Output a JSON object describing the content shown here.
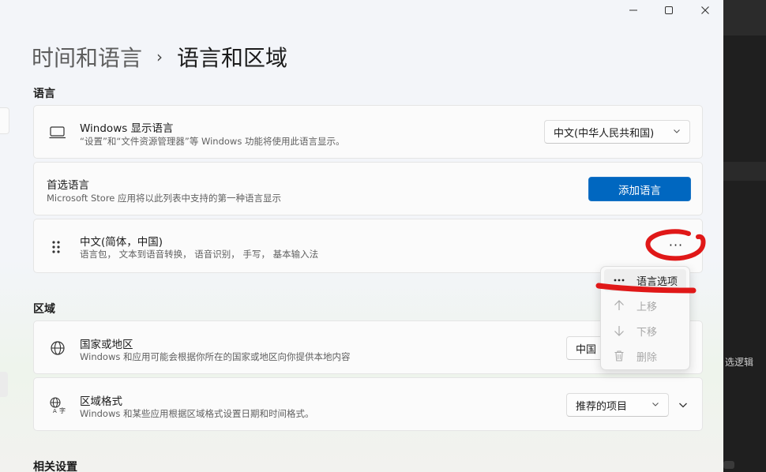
{
  "breadcrumb": {
    "parent": "时间和语言",
    "separator": "›",
    "current": "语言和区域"
  },
  "language_section": {
    "title": "语言",
    "display_language": {
      "title": "Windows 显示语言",
      "subtitle": "“设置”和“文件资源管理器”等 Windows 功能将使用此语言显示。",
      "value": "中文(中华人民共和国)",
      "icon": "monitor-icon"
    },
    "preferred": {
      "title": "首选语言",
      "subtitle": "Microsoft Store 应用将以此列表中支持的第一种语言显示",
      "add_button": "添加语言"
    },
    "installed": {
      "title": "中文(简体，中国)",
      "subtitle": "语言包， 文本到语音转换， 语音识别， 手写， 基本输入法",
      "more": "···",
      "icon": "drag-handle-icon"
    }
  },
  "context_menu": {
    "items": [
      {
        "label": "语言选项",
        "icon": "more-icon",
        "enabled": true
      },
      {
        "label": "上移",
        "icon": "arrow-up-icon",
        "enabled": false
      },
      {
        "label": "下移",
        "icon": "arrow-down-icon",
        "enabled": false
      },
      {
        "label": "删除",
        "icon": "trash-icon",
        "enabled": false
      }
    ]
  },
  "region_section": {
    "title": "区域",
    "country": {
      "title": "国家或地区",
      "subtitle": "Windows 和应用可能会根据你所在的国家或地区向你提供本地内容",
      "value": "中国",
      "icon": "globe-icon"
    },
    "format": {
      "title": "区域格式",
      "subtitle": "Windows 和某些应用根据区域格式设置日期和时间格式。",
      "value": "推荐的项目",
      "icon": "language-format-icon"
    }
  },
  "related_settings": {
    "title": "相关设置"
  },
  "background_text": "选逻辑",
  "colors": {
    "accent": "#0067c0",
    "annotation": "#e01818"
  }
}
